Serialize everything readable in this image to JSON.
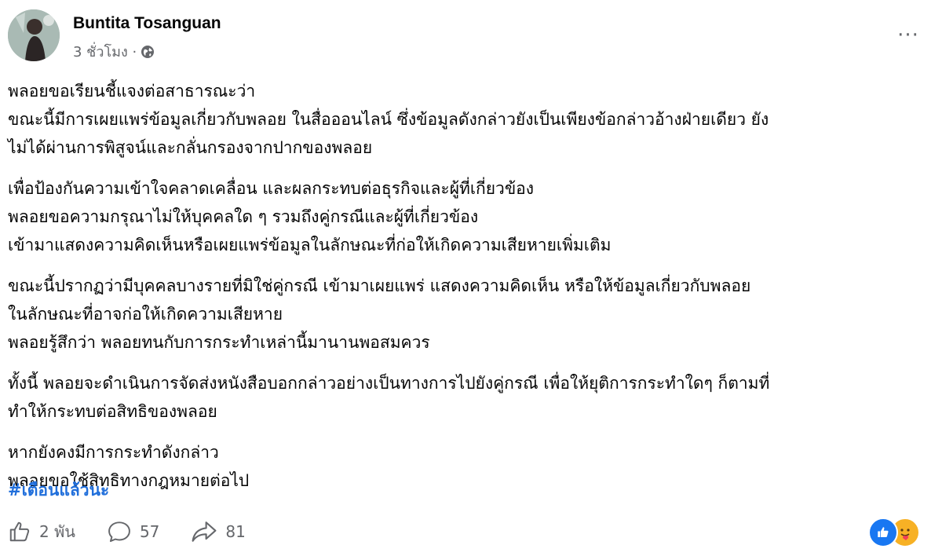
{
  "post": {
    "author": "Buntita Tosanguan",
    "time": "3 ชั่วโมง ·",
    "privacy_icon": "globe-icon",
    "more_icon": "more-options-icon",
    "more_glyph": "···",
    "paragraphs": [
      [
        "พลอยขอเรียนชี้แจงต่อสาธารณะว่า",
        "ขณะนี้มีการเผยแพร่ข้อมูลเกี่ยวกับพลอย ในสื่อออนไลน์  ซึ่งข้อมูลดังกล่าวยังเป็นเพียงข้อกล่าวอ้างฝ่ายเดียว ยัง",
        "ไม่ได้ผ่านการพิสูจน์และกลั่นกรองจากปากของพลอย"
      ],
      [
        "เพื่อป้องกันความเข้าใจคลาดเคลื่อน และผลกระทบต่อธุรกิจและผู้ที่เกี่ยวข้อง",
        "พลอยขอความกรุณาไม่ให้บุคคลใด ๆ รวมถึงคู่กรณีและผู้ที่เกี่ยวข้อง",
        "เข้ามาแสดงความคิดเห็นหรือเผยแพร่ข้อมูลในลักษณะที่ก่อให้เกิดความเสียหายเพิ่มเติม"
      ],
      [
        "ขณะนี้ปรากฏว่ามีบุคคลบางรายที่มิใช่คู่กรณี เข้ามาเผยแพร่ แสดงความคิดเห็น หรือให้ข้อมูลเกี่ยวกับพลอย",
        "ในลักษณะที่อาจก่อให้เกิดความเสียหาย",
        "พลอยรู้สึกว่า พลอยทนกับการกระทำเหล่านี้มานานพอสมควร"
      ],
      [
        "ทั้งนี้ พลอยจะดำเนินการจัดส่งหนังสือบอกกล่าวอย่างเป็นทางการไปยังคู่กรณี  เพื่อให้ยุติการกระทำใดๆ ก็ตามที่",
        "ทำให้กระทบต่อสิทธิของพลอย"
      ],
      [
        "หากยังคงมีการกระทำดังกล่าว",
        "พลอยขอใช้สิทธิทางกฎหมายต่อไป"
      ]
    ],
    "hashtag": "#เตือนแล้วนะ"
  },
  "footer": {
    "like_count": "2 พัน",
    "comment_count": "57",
    "share_count": "81",
    "reactions": [
      "like-reaction-icon",
      "care-reaction-icon"
    ]
  },
  "colors": {
    "hashtag": "#216fdb",
    "secondary_text": "#65676b",
    "like_blue": "#1877f2",
    "care_yellow": "#f7b125"
  }
}
